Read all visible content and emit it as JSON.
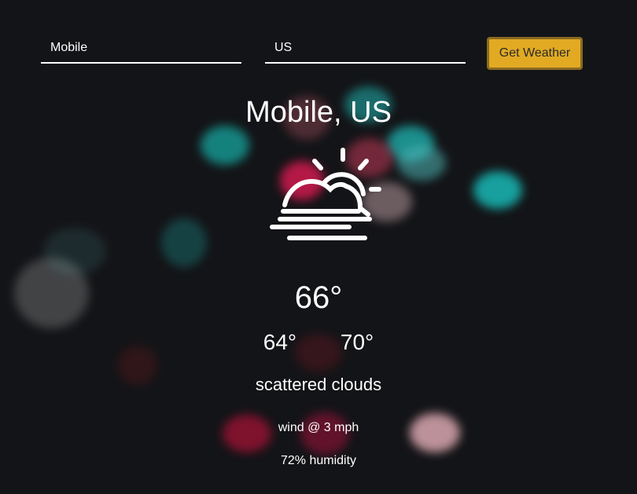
{
  "form": {
    "city_value": "Mobile",
    "country_value": "US",
    "button_label": "Get Weather"
  },
  "weather": {
    "location": "Mobile, US",
    "icon": "partly-cloudy-fog-icon",
    "temperature": "66°",
    "temp_min": "64°",
    "temp_max": "70°",
    "description": "scattered clouds",
    "wind": "wind @ 3 mph",
    "humidity": "72% humidity"
  },
  "colors": {
    "background": "#131417",
    "accent_button": "#e2aa23",
    "text": "#ffffff"
  }
}
